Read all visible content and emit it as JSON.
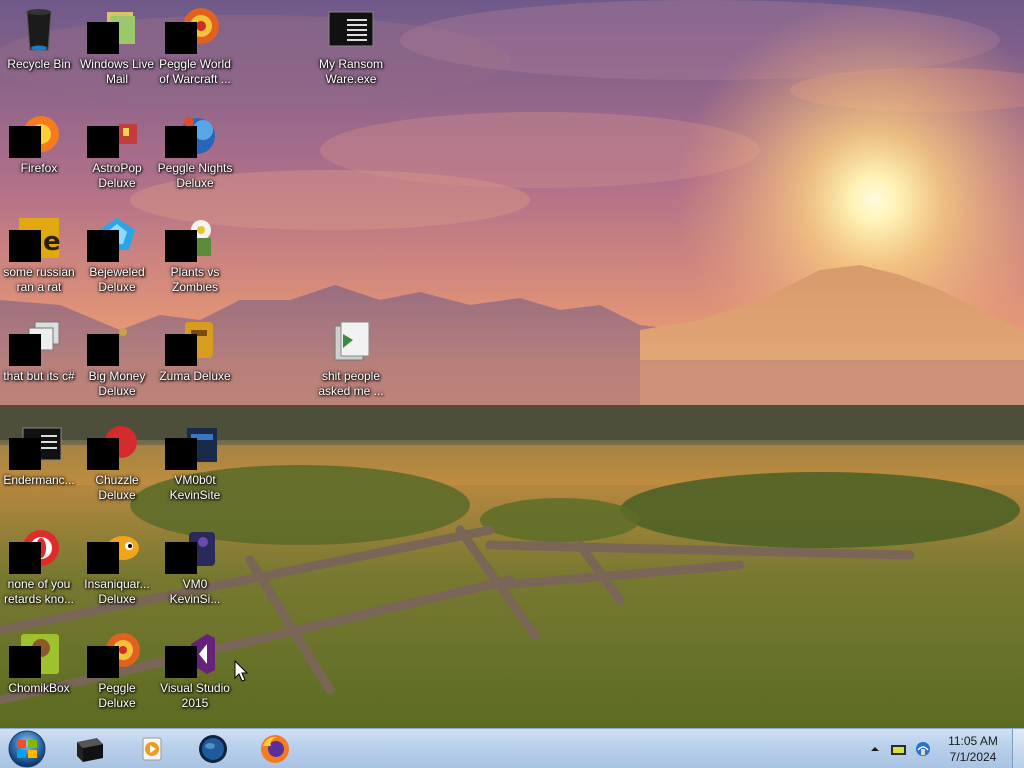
{
  "desktop": {
    "icons": [
      {
        "id": "recycle-bin",
        "label": "Recycle Bin",
        "icon": "recycle-bin-icon"
      },
      {
        "id": "windows-live-mail",
        "label": "Windows Live Mail",
        "icon": "mail-icon"
      },
      {
        "id": "peggle-world-of-warcraft",
        "label": "Peggle World of Warcraft ...",
        "icon": "peggle-icon"
      },
      {
        "id": "my-ransomware",
        "label": "My Ransom Ware.exe",
        "icon": "console-app-icon"
      },
      {
        "id": "firefox",
        "label": "Firefox",
        "icon": "firefox-icon"
      },
      {
        "id": "astropop",
        "label": "AstroPop Deluxe",
        "icon": "astropop-icon"
      },
      {
        "id": "peggle-nights",
        "label": "Peggle Nights Deluxe",
        "icon": "peggle-nights-icon"
      },
      {
        "id": "some-russian",
        "label": "some russian ran a rat",
        "icon": "app-icon"
      },
      {
        "id": "bejeweled",
        "label": "Bejeweled Deluxe",
        "icon": "bejeweled-icon"
      },
      {
        "id": "plants-vs-zombies",
        "label": "Plants vs Zombies",
        "icon": "pvz-icon"
      },
      {
        "id": "that-but-its-c",
        "label": "that but its c#",
        "icon": "stacked-windows-icon"
      },
      {
        "id": "big-money",
        "label": "Big Money Deluxe",
        "icon": "big-money-icon"
      },
      {
        "id": "zuma",
        "label": "Zuma Deluxe",
        "icon": "zuma-icon"
      },
      {
        "id": "shit-people-asked",
        "label": "shit people asked me ...",
        "icon": "folder-icon"
      },
      {
        "id": "endermanch",
        "label": "Endermanc...",
        "icon": "console-app-icon"
      },
      {
        "id": "chuzzle",
        "label": "Chuzzle Deluxe",
        "icon": "chuzzle-icon"
      },
      {
        "id": "vm0b0t-kevinsite",
        "label": "VM0b0t KevinSite",
        "icon": "vm-icon"
      },
      {
        "id": "none-of-you",
        "label": "none of you retards kno...",
        "icon": "opera-icon"
      },
      {
        "id": "insaniquarium",
        "label": "Insaniquar... Deluxe",
        "icon": "fish-icon"
      },
      {
        "id": "vm0-kevinsi",
        "label": "VM0 KevinSi...",
        "icon": "vm-icon"
      },
      {
        "id": "chomikbox",
        "label": "ChomikBox",
        "icon": "chomikbox-icon"
      },
      {
        "id": "peggle-deluxe",
        "label": "Peggle Deluxe",
        "icon": "peggle-icon"
      },
      {
        "id": "visual-studio-2015",
        "label": "Visual Studio 2015",
        "icon": "visual-studio-icon"
      }
    ]
  },
  "taskbar": {
    "start_icon": "windows-start-orb",
    "pinned": [
      {
        "id": "tb-console",
        "icon": "console-window-icon"
      },
      {
        "id": "tb-media-player",
        "icon": "media-player-icon"
      },
      {
        "id": "tb-globe",
        "icon": "globe-icon"
      },
      {
        "id": "tb-firefox",
        "icon": "firefox-icon"
      }
    ],
    "tray": {
      "icons": [
        "show-hidden-icons-arrow",
        "battery-icon",
        "network-icon"
      ],
      "time": "11:05 AM",
      "date": "7/1/2024"
    }
  },
  "colors": {
    "taskbar_top": "#cfe0f3",
    "taskbar_bottom": "#a9c3e4",
    "label_text": "#ffffff"
  }
}
